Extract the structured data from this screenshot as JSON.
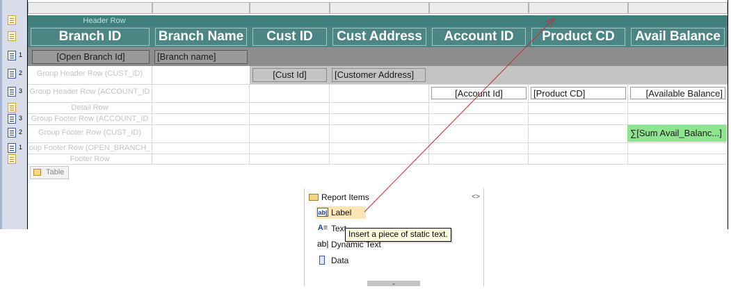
{
  "table": {
    "columns": [
      {
        "header": "Branch ID"
      },
      {
        "header": "Branch Name"
      },
      {
        "header": "Cust ID"
      },
      {
        "header": "Cust Address"
      },
      {
        "header": "Account ID"
      },
      {
        "header": "Product CD"
      },
      {
        "header": "Avail Balance"
      }
    ],
    "row_labels": {
      "header_row": "Header Row",
      "group_header_cust": "Group Header Row (CUST_ID)",
      "group_header_account": "Group Header Row (ACCOUNT_ID",
      "detail_row": "Detail Row",
      "group_footer_account": "Group Footer Row (ACCOUNT_ID",
      "group_footer_cust": "Group Footer Row (CUST_ID)",
      "group_footer_branch": "oup Footer Row (OPEN_BRANCH_",
      "footer_row": "Footer Row"
    },
    "group1": {
      "branch_id": "[Open Branch Id]",
      "branch_name": "[Branch name]"
    },
    "group2": {
      "cust_id": "[Cust Id]",
      "cust_address": "[Customer Address]"
    },
    "group3": {
      "account_id": "[Account Id]",
      "product_cd": "[Product CD]",
      "avail_balance": "[Available Balance]"
    },
    "footer_sum": "∑[Sum Avail_Balanc...]",
    "handle_numbers": {
      "g1": "1",
      "g2": "2",
      "g3": "3",
      "f3": "3",
      "f2": "2",
      "f1": "1"
    },
    "tab_label": "Table"
  },
  "palette": {
    "title": "Report Items",
    "collapse_glyph": "<>",
    "items": [
      {
        "label": "Label",
        "icon": "label-icon",
        "icon_glyph": "ab|"
      },
      {
        "label": "Text",
        "icon": "text-icon",
        "icon_glyph": "A≡"
      },
      {
        "label": "Dynamic Text",
        "icon": "dynamic-text-icon",
        "icon_glyph": "ab|"
      },
      {
        "label": "Data",
        "icon": "data-icon",
        "icon_glyph": ""
      }
    ],
    "scroll_glyph": "⌄"
  },
  "tooltip": "Insert a piece of static text.",
  "colors": {
    "header_teal": "#4b8684",
    "group1_dark": "#8d8d8d",
    "group2_light": "#c4c4c4",
    "sum_green": "#8fe48f",
    "drag_arrow": "#cc2a2a"
  }
}
